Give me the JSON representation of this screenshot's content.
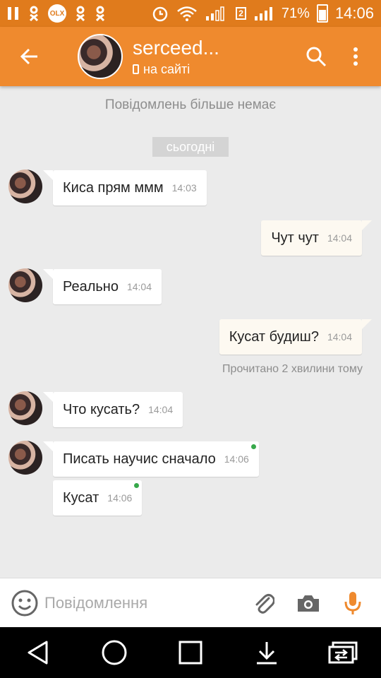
{
  "status_bar": {
    "battery": "71%",
    "time": "14:06",
    "sim": "2",
    "olx": "OLX"
  },
  "app_bar": {
    "title": "serceed...",
    "subtitle": "на сайті"
  },
  "chat": {
    "no_more_messages": "Повідомлень більше немає",
    "date_divider": "сьогодні",
    "read_receipt": "Прочитано 2 хвилини тому",
    "messages": [
      {
        "dir": "in",
        "text": "Киса прям ммм",
        "time": "14:03"
      },
      {
        "dir": "out",
        "text": "Чут чут",
        "time": "14:04"
      },
      {
        "dir": "in",
        "text": "Реально",
        "time": "14:04"
      },
      {
        "dir": "out",
        "text": "Кусат будиш?",
        "time": "14:04"
      },
      {
        "dir": "in",
        "text": "Что кусать?",
        "time": "14:04"
      },
      {
        "dir": "in",
        "text": "Писать научис сначало",
        "time": "14:06"
      },
      {
        "dir": "in",
        "text": "Кусат",
        "time": "14:06"
      }
    ]
  },
  "input": {
    "placeholder": "Повідомлення"
  },
  "colors": {
    "status_bar": "#e07b1c",
    "app_bar": "#ef8a2e",
    "chat_bg": "#ebebeb",
    "mic": "#ef8a2e",
    "online_dot": "#37a84a"
  },
  "icons": {
    "back": "arrow-left-icon",
    "search": "search-icon",
    "more": "more-vertical-icon",
    "emoji": "smiley-icon",
    "attach": "paperclip-icon",
    "camera": "camera-icon",
    "mic": "microphone-icon"
  }
}
